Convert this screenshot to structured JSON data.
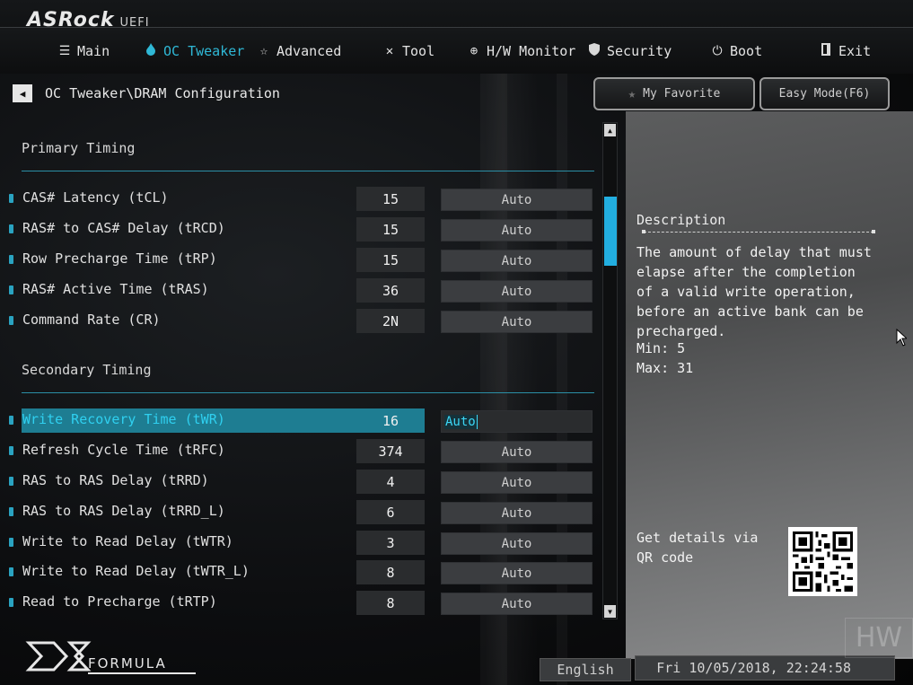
{
  "brand": {
    "logo": "ASRock",
    "suffix": "UEFI"
  },
  "nav": [
    {
      "label": "Main",
      "icon": "list-icon",
      "active": false
    },
    {
      "label": "OC Tweaker",
      "icon": "flame-icon",
      "active": true
    },
    {
      "label": "Advanced",
      "icon": "star-outline-icon",
      "active": false
    },
    {
      "label": "Tool",
      "icon": "tools-icon",
      "active": false
    },
    {
      "label": "H/W Monitor",
      "icon": "monitor-target-icon",
      "active": false
    },
    {
      "label": "Security",
      "icon": "shield-icon",
      "active": false
    },
    {
      "label": "Boot",
      "icon": "power-icon",
      "active": false
    },
    {
      "label": "Exit",
      "icon": "exit-door-icon",
      "active": false
    }
  ],
  "breadcrumb": {
    "text": "OC Tweaker\\DRAM Configuration"
  },
  "buttons": {
    "favorite": "My Favorite",
    "easy_mode": "Easy Mode(F6)"
  },
  "primary": {
    "title": "Primary Timing",
    "rows": [
      {
        "label": "CAS# Latency (tCL)",
        "value": "15",
        "option": "Auto"
      },
      {
        "label": "RAS# to CAS# Delay (tRCD)",
        "value": "15",
        "option": "Auto"
      },
      {
        "label": "Row Precharge Time (tRP)",
        "value": "15",
        "option": "Auto"
      },
      {
        "label": "RAS# Active Time (tRAS)",
        "value": "36",
        "option": "Auto"
      },
      {
        "label": "Command Rate (CR)",
        "value": "2N",
        "option": "Auto"
      }
    ]
  },
  "secondary": {
    "title": "Secondary Timing",
    "rows": [
      {
        "label": "Write Recovery Time (tWR)",
        "value": "16",
        "option": "Auto",
        "selected": true
      },
      {
        "label": "Refresh Cycle Time (tRFC)",
        "value": "374",
        "option": "Auto"
      },
      {
        "label": "RAS to RAS Delay (tRRD)",
        "value": "4",
        "option": "Auto"
      },
      {
        "label": "RAS to RAS Delay (tRRD_L)",
        "value": "6",
        "option": "Auto"
      },
      {
        "label": "Write to Read Delay (tWTR)",
        "value": "3",
        "option": "Auto"
      },
      {
        "label": "Write to Read Delay (tWTR_L)",
        "value": "8",
        "option": "Auto"
      },
      {
        "label": "Read to Precharge (tRTP)",
        "value": "8",
        "option": "Auto"
      }
    ]
  },
  "description": {
    "title": "Description",
    "text": "The amount of delay that must elapse after the completion of a valid write operation, before an active bank can be precharged.",
    "min": "Min: 5",
    "max": "Max: 31",
    "qr_text": "Get details via QR code"
  },
  "footer": {
    "brand": "FORMULA",
    "language": "English",
    "datetime": "Fri 10/05/2018, 22:24:58",
    "watermark": "HW"
  }
}
